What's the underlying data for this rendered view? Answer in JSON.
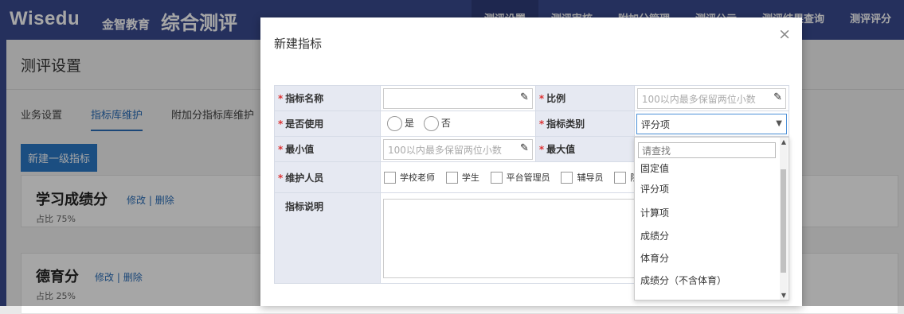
{
  "header": {
    "logo": "Wisedu",
    "logo_cn": "金智教育",
    "app_title": "综合测评",
    "nav": [
      "测评设置",
      "测评审核",
      "附加分管理",
      "测评公示",
      "测评结果查询",
      "测评评分"
    ]
  },
  "page": {
    "title": "测评设置",
    "tabs": [
      "业务设置",
      "指标库维护",
      "附加分指标库维护"
    ],
    "new_button": "新建一级指标",
    "cards": [
      {
        "title": "学习成绩分",
        "edit": "修改",
        "sep": "|",
        "delete": "删除",
        "ratio": "占比  75%"
      },
      {
        "title": "德育分",
        "edit": "修改",
        "sep": "|",
        "delete": "删除",
        "ratio": "占比  25%"
      }
    ]
  },
  "modal": {
    "title": "新建指标",
    "close": "×",
    "req": "*",
    "labels": {
      "name": "指标名称",
      "ratio": "比例",
      "enabled": "是否使用",
      "category": "指标类别",
      "min": "最小值",
      "max": "最大值",
      "maintainer": "维护人员",
      "desc": "指标说明"
    },
    "placeholders": {
      "ratio": "100以内最多保留两位小数",
      "min": "100以内最多保留两位小数"
    },
    "radio": {
      "yes": "是",
      "no": "否"
    },
    "category_value": "评分项",
    "maintainers": [
      "学校老师",
      "学生",
      "平台管理员",
      "辅导员",
      "院"
    ],
    "dropdown": {
      "search_placeholder": "请查找",
      "options": [
        "固定值",
        "评分项",
        "计算项",
        "成绩分",
        "体育分",
        "成绩分（不含体育）"
      ]
    }
  }
}
